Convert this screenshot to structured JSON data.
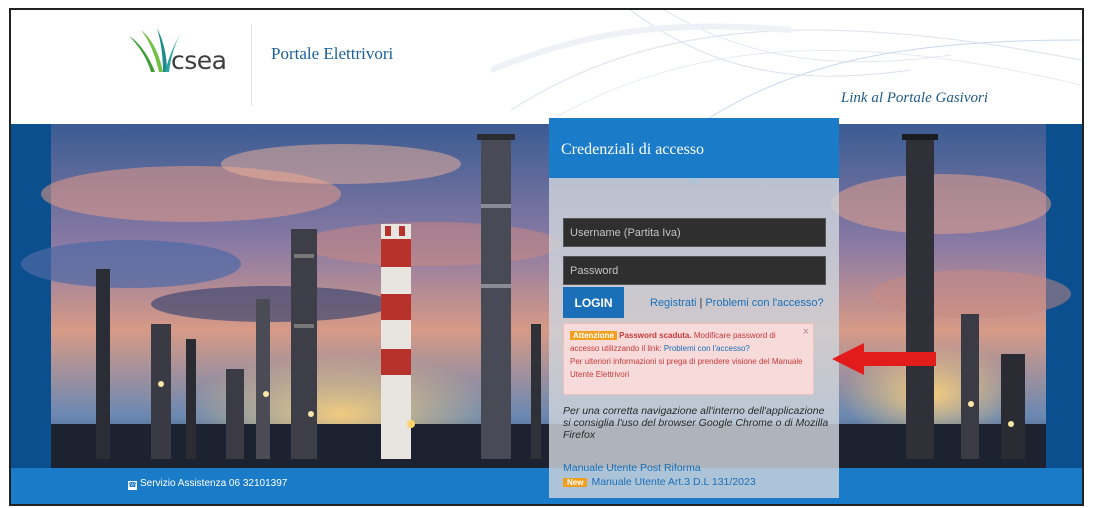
{
  "header": {
    "logo_text": "csea",
    "portal_title": "Portale Elettrivori",
    "gas_link": "Link al Portale Gasivori"
  },
  "login": {
    "title": "Credenziali di accesso",
    "username_placeholder": "Username (Partita Iva)",
    "password_placeholder": "Password",
    "login_button": "LOGIN",
    "register_link": "Registrati",
    "separator": "|",
    "problems_link": "Problemi con l'accesso?"
  },
  "alert": {
    "badge": "Attenzione",
    "bold_text": "Password scaduta.",
    "text1": " Modificare password di accesso utilizzando il link: ",
    "link": "Problemi con l'accesso?",
    "text2": "Per ulteriori informazioni si prega di prendere visione del Manuale Utente Elettrivori",
    "close": "×"
  },
  "nav_note": "Per una corretta navigazione all'interno dell'applicazione si consiglia l'uso del browser Google Chrome o di Mozilla Firefox",
  "manuals": {
    "manual1": "Manuale Utente Post Riforma",
    "new_badge": "New",
    "manual2": "Manuale Utente Art.3 D.L 131/2023"
  },
  "footer": {
    "assistance": "Servizio Assistenza 06 32101397"
  },
  "colors": {
    "primary_blue": "#1a7bc9",
    "alert_bg": "#f7dada",
    "badge_orange": "#f0a01e",
    "arrow_red": "#e21b1b"
  }
}
